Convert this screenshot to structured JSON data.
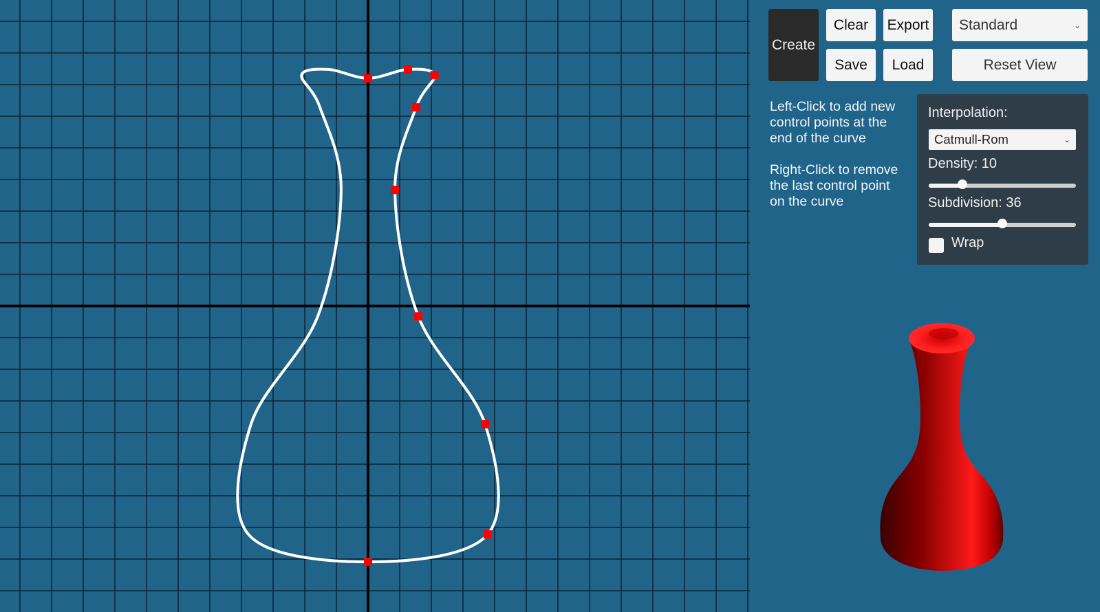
{
  "toolbar": {
    "create_label": "Create",
    "clear_label": "Clear",
    "export_label": "Export",
    "save_label": "Save",
    "load_label": "Load",
    "view_mode_value": "Standard",
    "reset_view_label": "Reset View"
  },
  "help": {
    "left_click": "Left-Click to add new control points at the end of the curve",
    "right_click": "Right-Click to remove the last control point on the curve"
  },
  "settings": {
    "interpolation_label": "Interpolation:",
    "interpolation_value": "Catmull-Rom",
    "density_label": "Density: 10",
    "density_fraction": 0.23,
    "subdivision_label": "Subdivision: 36",
    "subdivision_fraction": 0.5,
    "wrap_label": "Wrap",
    "wrap_checked": false
  },
  "editor": {
    "curve_color": "#ffffff",
    "control_point_color": "#ff0000",
    "grid_color": "#0c2233",
    "axis_color": "#000000",
    "mirrored": true,
    "control_points": [
      [
        0,
        7.2
      ],
      [
        1.26,
        7.48
      ],
      [
        2.1,
        7.3
      ],
      [
        1.52,
        6.28
      ],
      [
        0.85,
        3.67
      ],
      [
        1.59,
        -0.33
      ],
      [
        3.7,
        -3.74
      ],
      [
        3.78,
        -7.22
      ],
      [
        0,
        -8.09
      ]
    ]
  },
  "preview": {
    "model_color": "#ff1a1a"
  }
}
